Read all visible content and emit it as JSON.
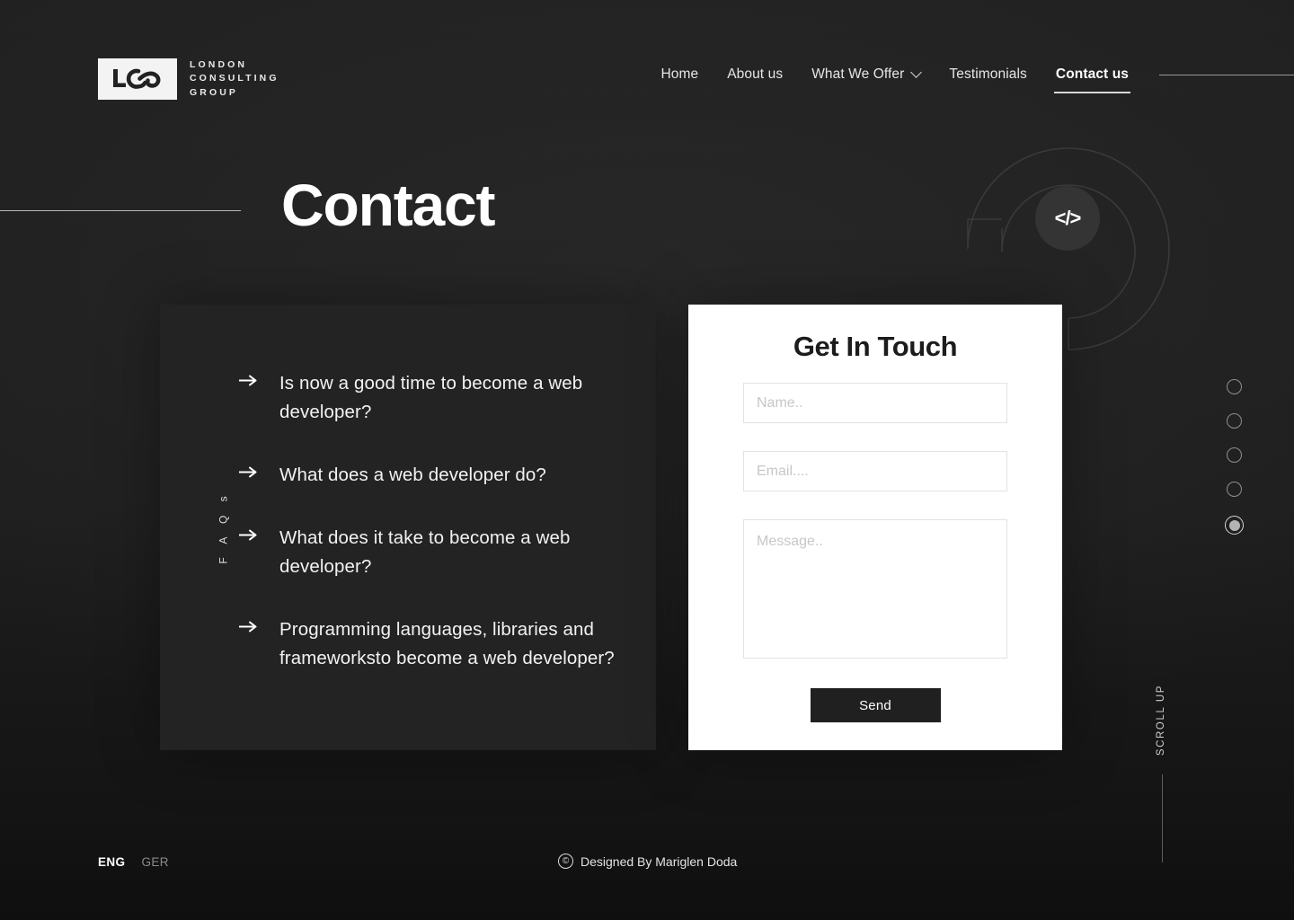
{
  "brand": {
    "logo_mark_text": "LCG",
    "name_lines": [
      "LONDON",
      "CONSULTING",
      "GROUP"
    ]
  },
  "nav": {
    "items": [
      {
        "label": "Home",
        "active": false,
        "has_chevron": false
      },
      {
        "label": "About us",
        "active": false,
        "has_chevron": false
      },
      {
        "label": "What We Offer",
        "active": false,
        "has_chevron": true
      },
      {
        "label": "Testimonials",
        "active": false,
        "has_chevron": false
      },
      {
        "label": "Contact us",
        "active": true,
        "has_chevron": false
      }
    ]
  },
  "hero": {
    "title": "Contact",
    "code_badge": "</>"
  },
  "faq": {
    "side_label": "F A Q s",
    "arrow_glyph": "arrow-right-icon",
    "items": [
      "Is now a good time to become a web developer?",
      "What does a web developer do?",
      "What does it take to become a web developer?",
      "Programming languages, libraries and frameworksto become a web developer?"
    ]
  },
  "form": {
    "title": "Get In Touch",
    "name": {
      "value": "",
      "placeholder": "Name.."
    },
    "email": {
      "value": "",
      "placeholder": "Email...."
    },
    "message": {
      "value": "",
      "placeholder": "Message.."
    },
    "submit_label": "Send"
  },
  "pagination": {
    "total": 5,
    "active_index": 5
  },
  "scroll": {
    "label": "SCROLL UP"
  },
  "footer": {
    "languages": [
      {
        "code": "ENG",
        "active": true
      },
      {
        "code": "GER",
        "active": false
      }
    ],
    "copyright_symbol": "©",
    "credit": "Designed By Mariglen Doda"
  },
  "colors": {
    "background": "#1f1f1f",
    "panel": "#232323",
    "card": "#ffffff",
    "accent": "#ffffff",
    "button": "#202020"
  }
}
